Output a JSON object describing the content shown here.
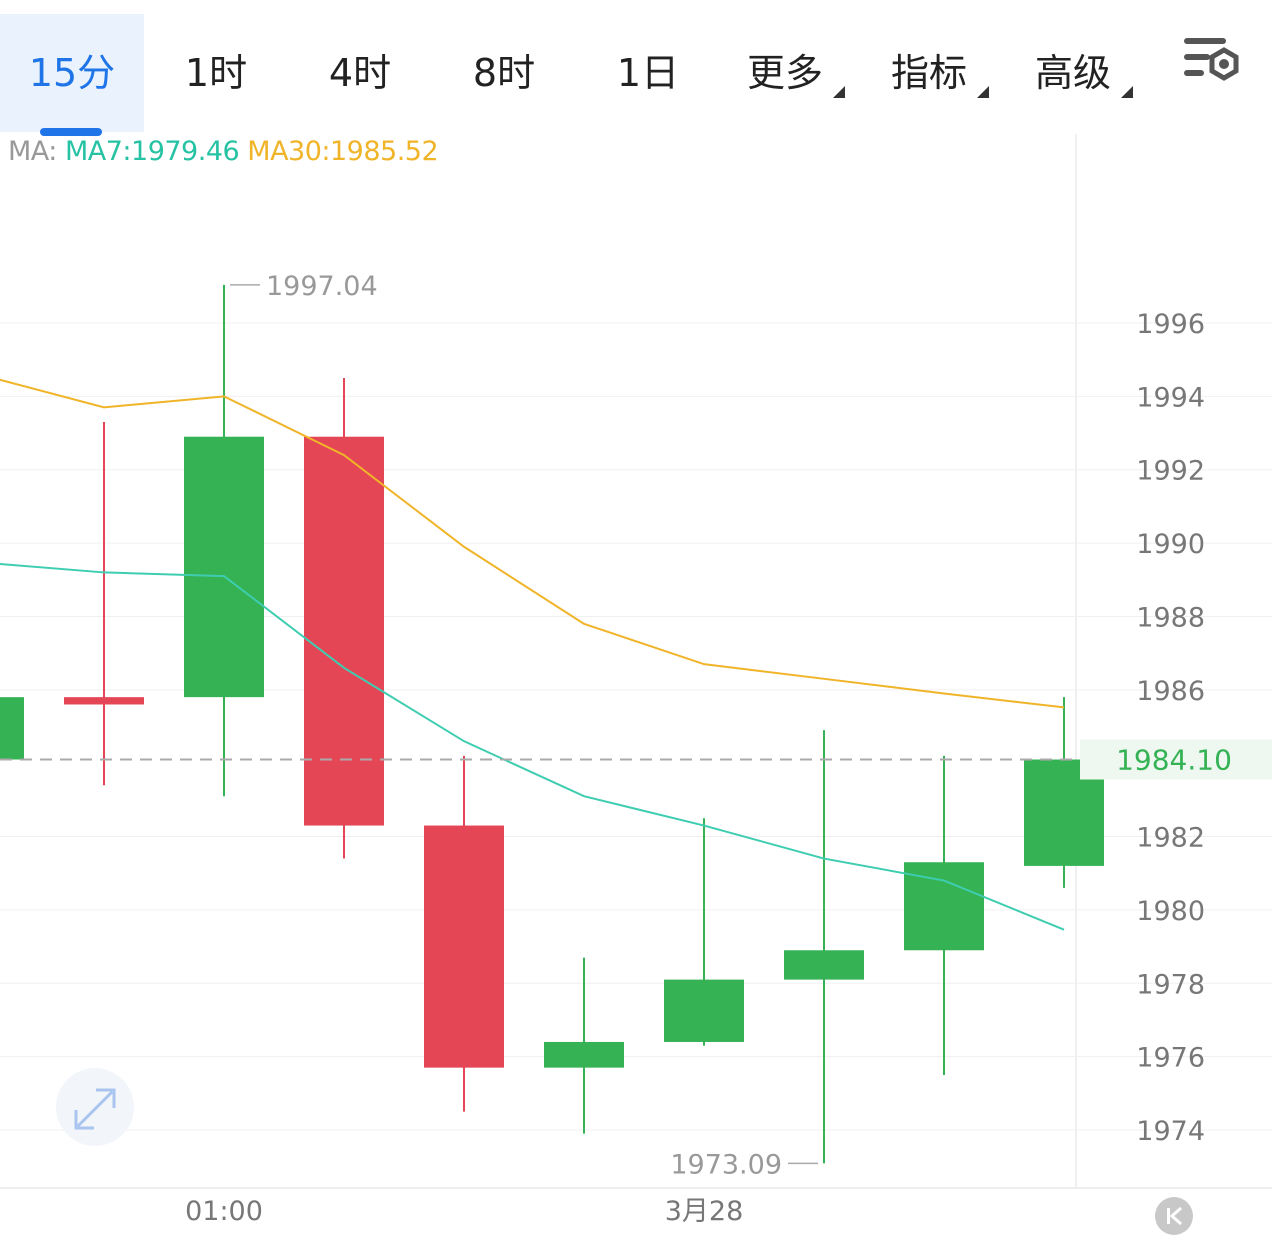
{
  "tabs": [
    {
      "label": "15分",
      "active": true,
      "caret": false
    },
    {
      "label": "1时",
      "active": false,
      "caret": false
    },
    {
      "label": "4时",
      "active": false,
      "caret": false
    },
    {
      "label": "8时",
      "active": false,
      "caret": false
    },
    {
      "label": "1日",
      "active": false,
      "caret": false
    },
    {
      "label": "更多",
      "active": false,
      "caret": true
    },
    {
      "label": "指标",
      "active": false,
      "caret": true
    },
    {
      "label": "高级",
      "active": false,
      "caret": true
    }
  ],
  "settings_icon": "chart-settings-icon",
  "ma_legend": {
    "label": "MA:",
    "ma7": "MA7:1979.46",
    "ma30": "MA30:1985.52"
  },
  "colors": {
    "up": "#35b254",
    "down": "#e44655",
    "ma7": "#3ecdb0",
    "ma30": "#f0b429",
    "accent": "#1f74e8",
    "grid": "#f0f0f0"
  },
  "chart_data": {
    "type": "candlestick",
    "y_ticks": [
      "1996",
      "1994",
      "1992",
      "1990",
      "1988",
      "1986",
      "1982",
      "1980",
      "1978",
      "1976",
      "1974"
    ],
    "ylim": [
      1972.5,
      1998
    ],
    "x_labels": [
      {
        "index": 1.5,
        "label": "01:00"
      },
      {
        "index": 5.5,
        "label": "3月28"
      }
    ],
    "current_price": "1984.10",
    "current_price_value": 1984.1,
    "high_label": {
      "index": 1.5,
      "value": 1997.04,
      "text": "1997.04"
    },
    "low_label": {
      "index": 6.5,
      "value": 1973.09,
      "text": "1973.09"
    },
    "candles": [
      {
        "index": -0.5,
        "open": 1984.1,
        "close": 1985.8,
        "high": 1985.8,
        "low": 1984.1
      },
      {
        "index": 0.5,
        "open": 1985.8,
        "close": 1985.6,
        "high": 1993.3,
        "low": 1983.4
      },
      {
        "index": 1.5,
        "open": 1985.8,
        "close": 1992.9,
        "high": 1997.04,
        "low": 1983.1
      },
      {
        "index": 2.5,
        "open": 1992.9,
        "close": 1982.3,
        "high": 1994.5,
        "low": 1981.4
      },
      {
        "index": 3.5,
        "open": 1982.3,
        "close": 1975.7,
        "high": 1984.2,
        "low": 1974.5
      },
      {
        "index": 4.5,
        "open": 1975.7,
        "close": 1976.4,
        "high": 1978.7,
        "low": 1973.9
      },
      {
        "index": 5.5,
        "open": 1976.4,
        "close": 1978.1,
        "high": 1982.5,
        "low": 1976.3
      },
      {
        "index": 6.5,
        "open": 1978.1,
        "close": 1978.9,
        "high": 1984.9,
        "low": 1973.09
      },
      {
        "index": 7.5,
        "open": 1978.9,
        "close": 1981.3,
        "high": 1984.2,
        "low": 1975.5
      },
      {
        "index": 8.5,
        "open": 1981.2,
        "close": 1984.1,
        "high": 1985.8,
        "low": 1980.6
      }
    ],
    "series": [
      {
        "name": "MA7",
        "points": [
          [
            -1,
            1989.6
          ],
          [
            0.5,
            1989.2
          ],
          [
            1.5,
            1989.1
          ],
          [
            2.5,
            1986.6
          ],
          [
            3.5,
            1984.6
          ],
          [
            4.5,
            1983.1
          ],
          [
            5.5,
            1982.3
          ],
          [
            6.5,
            1981.4
          ],
          [
            7.5,
            1980.8
          ],
          [
            8.5,
            1979.46
          ]
        ]
      },
      {
        "name": "MA30",
        "points": [
          [
            -1,
            1995.0
          ],
          [
            0.5,
            1993.7
          ],
          [
            1.5,
            1994.0
          ],
          [
            2.5,
            1992.4
          ],
          [
            3.5,
            1989.9
          ],
          [
            4.5,
            1987.8
          ],
          [
            5.5,
            1986.7
          ],
          [
            6.5,
            1986.3
          ],
          [
            7.5,
            1985.9
          ],
          [
            8.5,
            1985.52
          ]
        ]
      }
    ]
  },
  "expand_icon": "expand-icon",
  "back_icon": "skip-back-icon"
}
